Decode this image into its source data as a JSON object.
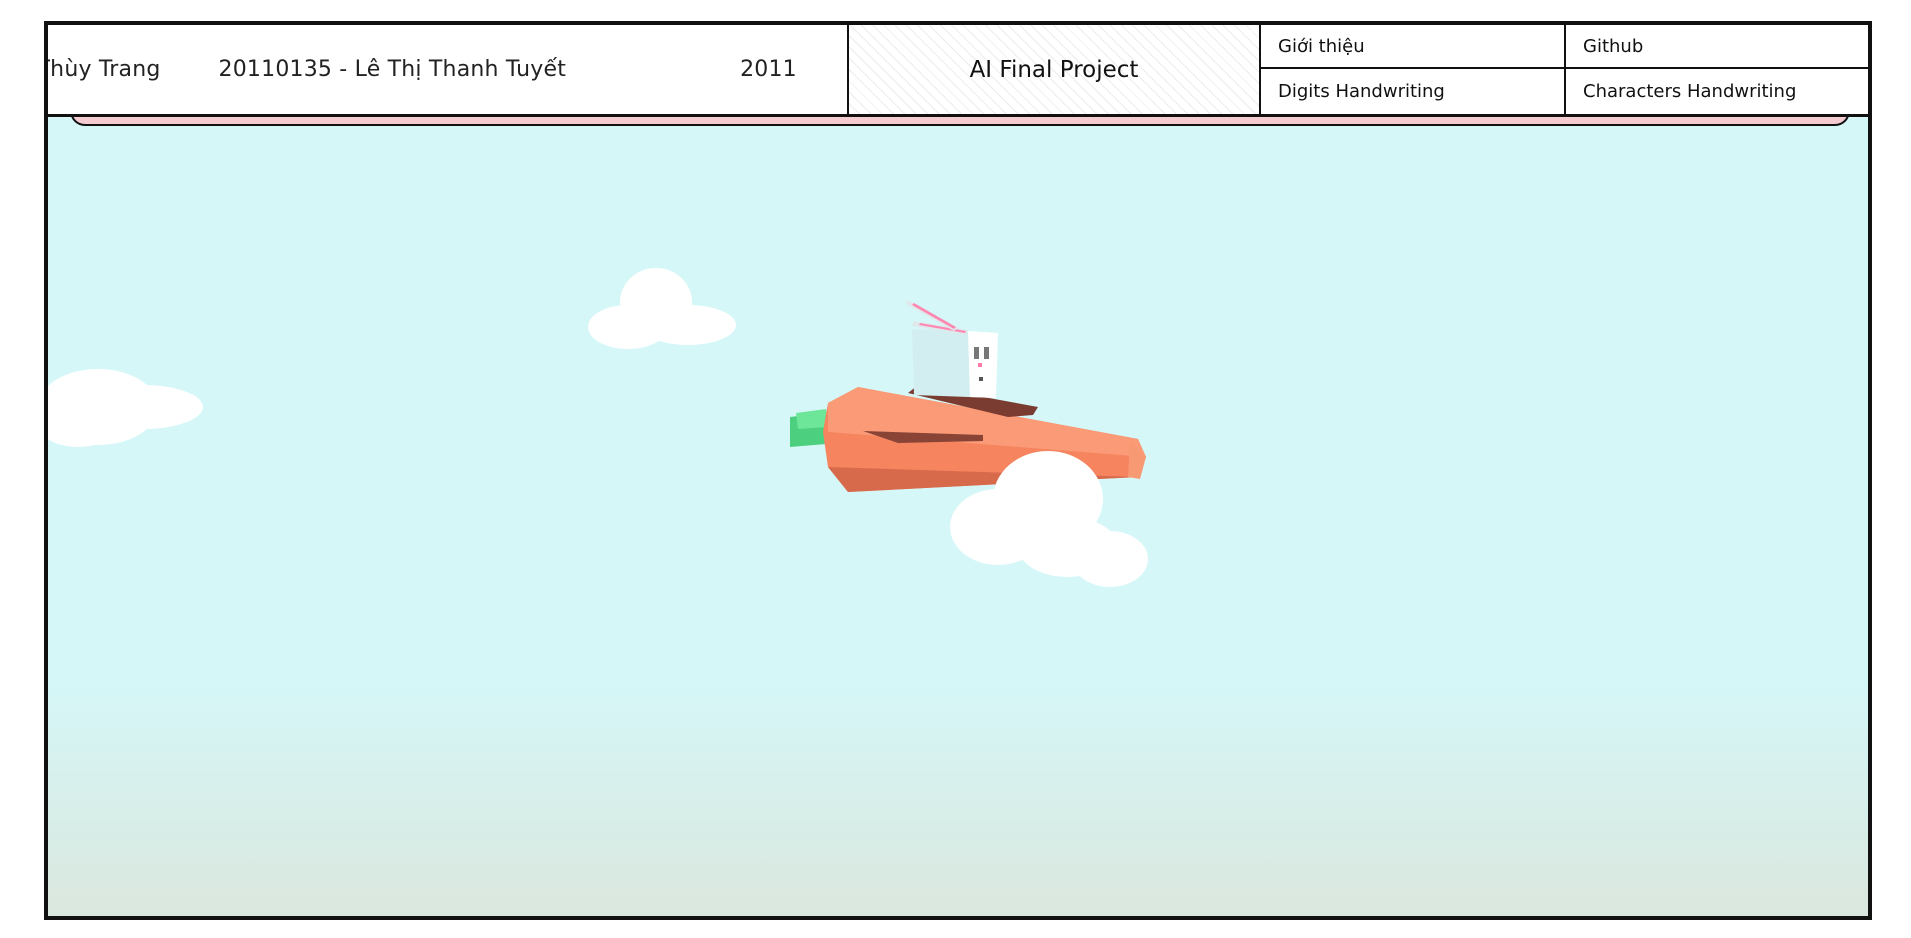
{
  "header": {
    "members": [
      "Nguyễn Thị Thùy Trang",
      "20110135 - Lê Thị Thanh Tuyết",
      "2011"
    ],
    "project_title": "AI Final Project"
  },
  "nav": {
    "items": [
      {
        "label": "Giới thiệu"
      },
      {
        "label": "Github"
      },
      {
        "label": "Digits Handwriting"
      },
      {
        "label": "Characters Handwriting"
      }
    ]
  },
  "scene": {
    "sky_color": "#d5f6f7",
    "horizon_color": "#dae7de",
    "carrot_color": "#f5845f",
    "carrot_leaf_color": "#4ccf7f",
    "cloud_color": "#ffffff",
    "accent_pink": "#f4cbd1"
  }
}
